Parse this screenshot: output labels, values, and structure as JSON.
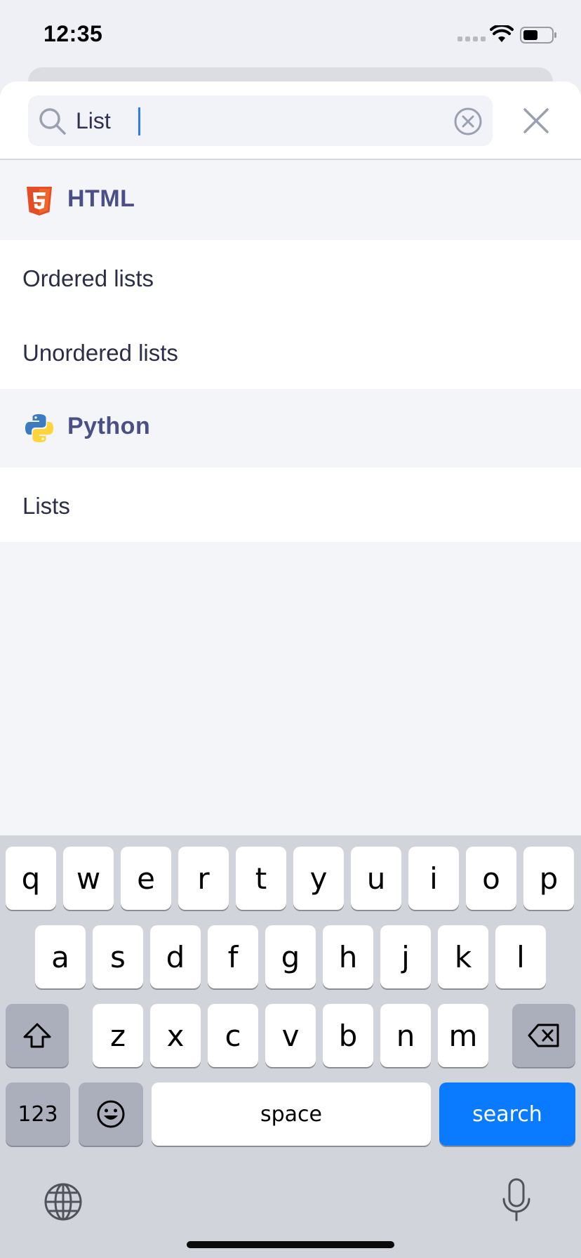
{
  "status_bar": {
    "time": "12:35"
  },
  "search": {
    "value": "List"
  },
  "sections": [
    {
      "title": "HTML",
      "icon": "html5-icon",
      "items": [
        "Ordered lists",
        "Unordered lists"
      ]
    },
    {
      "title": "Python",
      "icon": "python-icon",
      "items": [
        "Lists"
      ]
    }
  ],
  "keyboard": {
    "row1": [
      "q",
      "w",
      "e",
      "r",
      "t",
      "y",
      "u",
      "i",
      "o",
      "p"
    ],
    "row2": [
      "a",
      "s",
      "d",
      "f",
      "g",
      "h",
      "j",
      "k",
      "l"
    ],
    "row3": [
      "z",
      "x",
      "c",
      "v",
      "b",
      "n",
      "m"
    ],
    "numbers_label": "123",
    "space_label": "space",
    "search_label": "search"
  },
  "colors": {
    "accent": "#0a7bff",
    "section_title": "#4b4f87",
    "html5": "#e44d26"
  }
}
